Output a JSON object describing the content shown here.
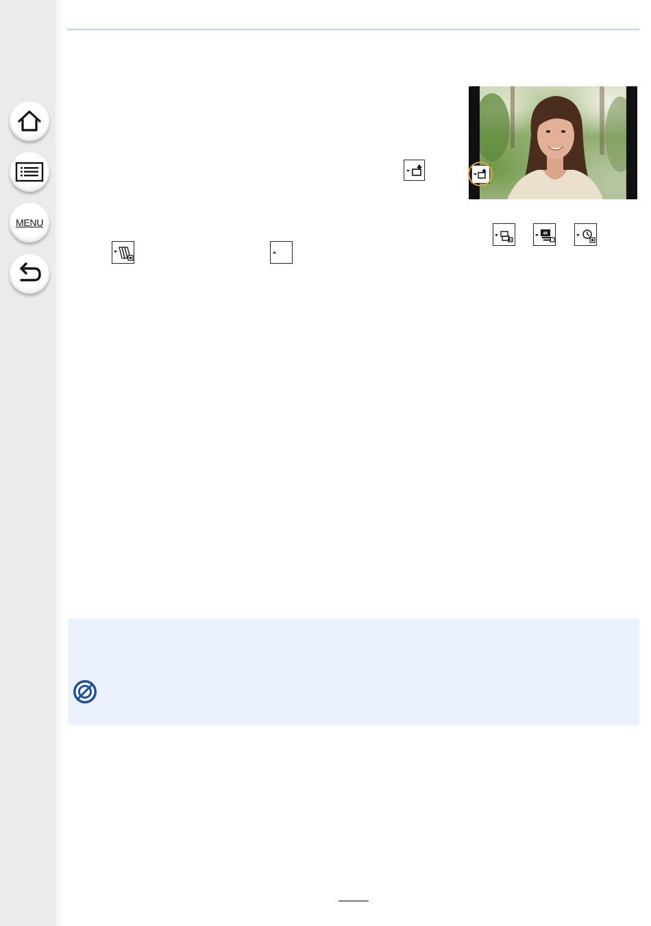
{
  "sidebar": {
    "buttons": [
      {
        "name": "home-button",
        "icon": "home-icon"
      },
      {
        "name": "contents-button",
        "icon": "list-icon"
      },
      {
        "name": "menu-button",
        "icon": "menu-icon",
        "label": "MENU"
      },
      {
        "name": "back-button",
        "icon": "return-icon"
      }
    ]
  },
  "document": {
    "inline_icons": [
      "shutter-type-icon",
      "burst-mode-icon",
      "4k-photo-icon",
      "self-timer-icon",
      "auto-bracket-icon",
      "single-drive-icon"
    ],
    "photo": {
      "subject": "woman-portrait",
      "overlay_icon": "shutter-type-icon",
      "highlight_color": "#e2a23c"
    },
    "info_box": {
      "background": "#eaf1fc",
      "icon": "not-available-icon",
      "icon_color": "#1a4fa8"
    },
    "page_number": ""
  },
  "colors": {
    "sidebar": "#ebebeb",
    "rule": "#c3d1e6",
    "accent_ring": "#e2a23c"
  }
}
